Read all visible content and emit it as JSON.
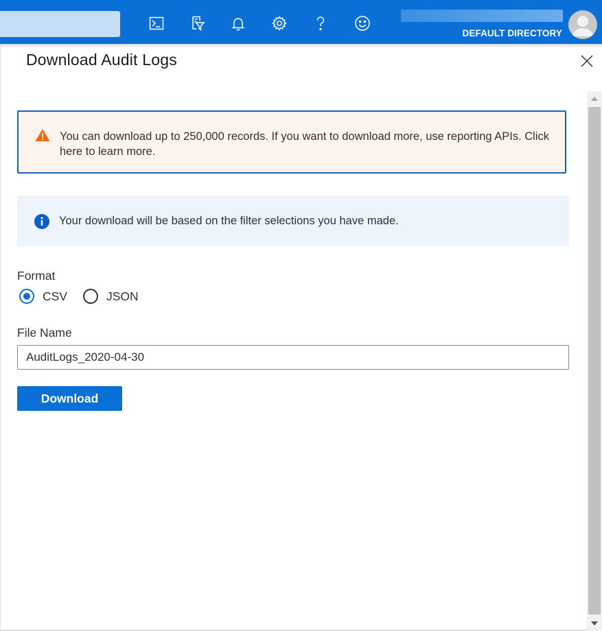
{
  "topbar": {
    "directory_label": "DEFAULT DIRECTORY",
    "icons": [
      "cloud-shell-icon",
      "directory-filter-icon",
      "notifications-icon",
      "settings-icon",
      "help-icon",
      "feedback-icon"
    ]
  },
  "panel": {
    "title": "Download Audit Logs",
    "warning_text": "You can download up to 250,000 records. If you want to download more, use reporting APIs. Click here to learn more.",
    "info_text": "Your download will be based on the filter selections you have made.",
    "format_label": "Format",
    "format_options": [
      {
        "label": "CSV",
        "selected": true
      },
      {
        "label": "JSON",
        "selected": false
      }
    ],
    "file_name_label": "File Name",
    "file_name_value": "AuditLogs_2020-04-30",
    "download_label": "Download"
  },
  "colors": {
    "brand": "#0a6fd6",
    "warning_bg": "#fdf4ee",
    "warning_icon": "#f7630c",
    "info_bg": "#edf4fc"
  }
}
